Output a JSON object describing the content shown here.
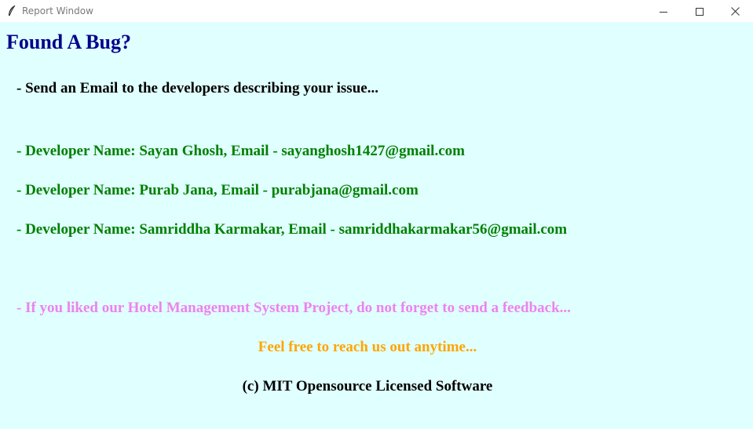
{
  "window": {
    "title": "Report Window",
    "icon": "feather-icon",
    "background": "#e0ffff",
    "controls": {
      "minimize_icon": "minimize-icon",
      "maximize_icon": "maximize-icon",
      "close_icon": "close-icon"
    }
  },
  "report": {
    "heading": "Found A Bug?",
    "send_email": "- Send an Email to the developers describing your issue...",
    "developers": [
      "- Developer Name: Sayan Ghosh, Email - sayanghosh1427@gmail.com",
      "- Developer Name: Purab Jana, Email - purabjana@gmail.com",
      "- Developer Name: Samriddha Karmakar, Email - samriddhakarmakar56@gmail.com"
    ],
    "feedback": "- If you liked our Hotel Management System Project, do not forget to send a feedback...",
    "reach_out": "Feel free to reach us out anytime...",
    "license": "(c) MIT Opensource Licensed Software"
  },
  "colors": {
    "heading": "#00008b",
    "developers": "#008000",
    "feedback": "#ee82ee",
    "reach_out": "#ffa500",
    "text": "#000000"
  }
}
